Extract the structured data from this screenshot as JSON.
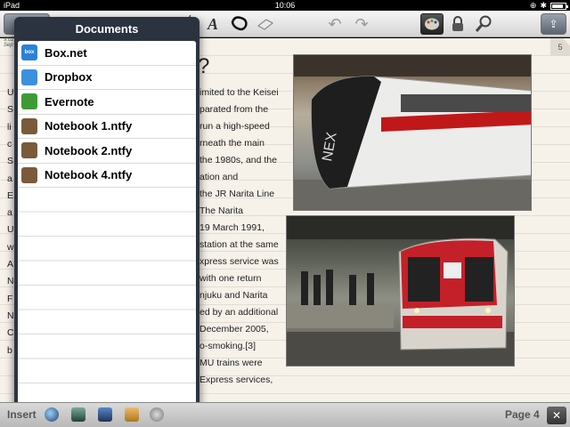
{
  "status_bar": {
    "device": "iPad",
    "time": "10:06"
  },
  "toolbar": {
    "notebooks_button": "N"
  },
  "page": {
    "timestamp": [
      "9:02",
      "Sep"
    ],
    "title_fragment": "?",
    "page_tab_number": "5",
    "text_left": [
      "U",
      "S",
      "li",
      "c",
      "S",
      "a",
      "E",
      "a",
      "U",
      "w",
      "A",
      "N",
      "F",
      "N",
      "C",
      "b"
    ],
    "text_right": [
      "imited to the Keisei",
      "parated from the",
      "run a high-speed",
      "rneath the main",
      " the 1980s, and the",
      "ation and",
      " the JR Narita Line",
      " The Narita",
      "19 March 1991,",
      "station at the same",
      "xpress service was",
      "with one return",
      "njuku and Narita",
      "ed by an additional",
      "December 2005,",
      "o-smoking.[3]",
      "MU trains were",
      "Express services,"
    ]
  },
  "popover": {
    "title": "Documents",
    "items": [
      {
        "label": "Box.net",
        "icon": "box-net-icon",
        "icon_text": "box",
        "color": "#2a82d6"
      },
      {
        "label": "Dropbox",
        "icon": "dropbox-icon",
        "icon_text": "",
        "color": "#3d8fe0"
      },
      {
        "label": "Evernote",
        "icon": "evernote-icon",
        "icon_text": "",
        "color": "#3f9a35"
      },
      {
        "label": "Notebook 1.ntfy",
        "icon": "notebook-icon",
        "icon_text": "",
        "color": "#7a5a3a"
      },
      {
        "label": "Notebook 2.ntfy",
        "icon": "notebook-icon",
        "icon_text": "",
        "color": "#7a5a3a"
      },
      {
        "label": "Notebook 4.ntfy",
        "icon": "notebook-icon",
        "icon_text": "",
        "color": "#7a5a3a"
      }
    ]
  },
  "bottom_bar": {
    "insert_label": "Insert",
    "page_indicator": "Page 4",
    "close_symbol": "✕"
  }
}
